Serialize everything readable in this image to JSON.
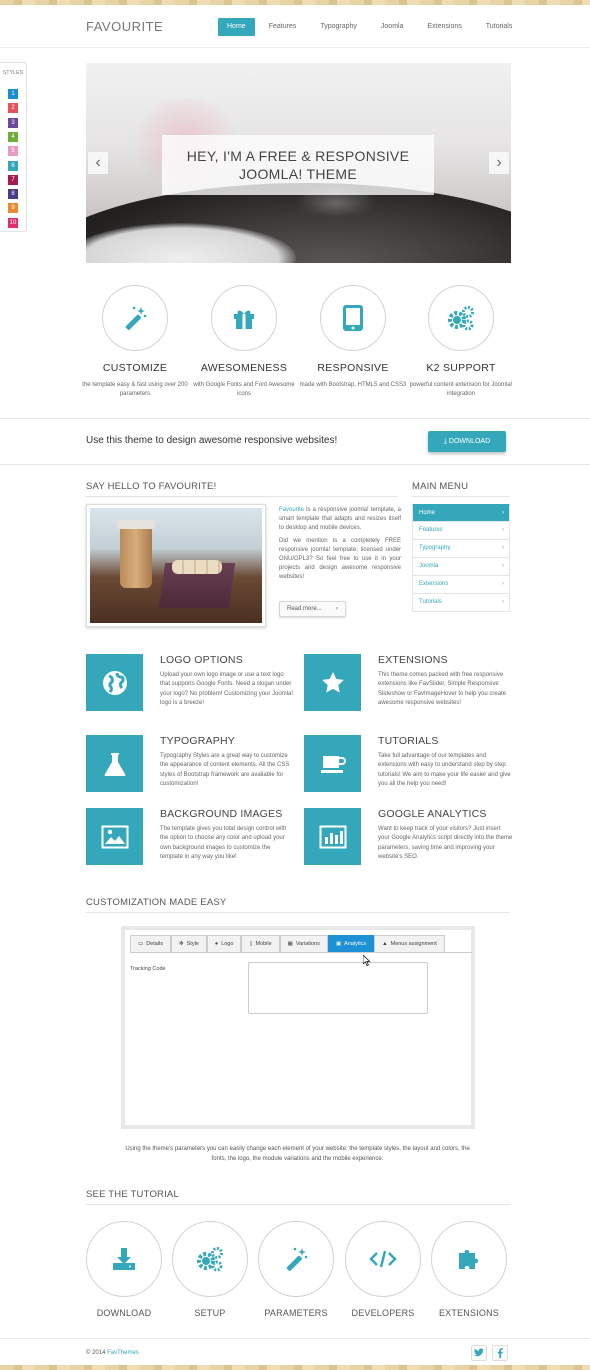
{
  "brand": {
    "name": "FAVOURITE",
    "accent": "#34a8ba"
  },
  "nav": {
    "items": [
      "Home",
      "Features",
      "Typography",
      "Joomla",
      "Extensions",
      "Tutorials"
    ],
    "active": "Home"
  },
  "styles_panel": {
    "label": "STYLES",
    "swatches": [
      {
        "n": "1",
        "color": "#1b8fd0"
      },
      {
        "n": "2",
        "color": "#e5535e"
      },
      {
        "n": "3",
        "color": "#6a4a9a"
      },
      {
        "n": "4",
        "color": "#6fae3a"
      },
      {
        "n": "5",
        "color": "#e89ac3"
      },
      {
        "n": "6",
        "color": "#34a8ba"
      },
      {
        "n": "7",
        "color": "#a61b52"
      },
      {
        "n": "8",
        "color": "#4a3a8a"
      },
      {
        "n": "9",
        "color": "#e88a2e"
      },
      {
        "n": "10",
        "color": "#e0316d"
      }
    ]
  },
  "hero": {
    "line1": "HEY, I'M A FREE & RESPONSIVE",
    "line2": "JOOMLA! THEME",
    "prev": "prev-arrow",
    "next": "next-arrow"
  },
  "features": [
    {
      "title": "CUSTOMIZE",
      "text": "the template easy & fast using over 200 parameters",
      "icon": "magic-wand-icon"
    },
    {
      "title": "AWESOMENESS",
      "text": "with Google Fonts and Font Awesome icons",
      "icon": "gift-icon"
    },
    {
      "title": "RESPONSIVE",
      "text": "made with Bootstrap, HTML5 and CSS3",
      "icon": "tablet-icon"
    },
    {
      "title": "K2 SUPPORT",
      "text": "powerful content extension for Joomla! integration",
      "icon": "gears-icon"
    }
  ],
  "band": {
    "message": "Use this theme to design awesome responsive websites!",
    "button": "DOWNLOAD"
  },
  "hello": {
    "heading": "SAY HELLO TO FAVOURITE!",
    "link": "Favourite",
    "p1": " is a responsive joomla! template, a smart template that adapts and resizes itself to desktop and mobile devices.",
    "p2": "Did we mention is a completely FREE responsive joomla! template, licensed under GNU/GPL3? So feel free to use it in your projects and design awesome responsive websites!",
    "readmore": "Read more..."
  },
  "main_menu": {
    "heading": "MAIN MENU",
    "items": [
      "Home",
      "Features",
      "Typography",
      "Joomla",
      "Extensions",
      "Tutorials"
    ]
  },
  "feature_boxes": [
    {
      "title": "LOGO OPTIONS",
      "text": "Upload your own logo image or use a text logo that supports Google Fonts. Need a slogan under your logo? No problem! Customizing your Joomla! logo is a breeze!",
      "icon": "globe-icon"
    },
    {
      "title": "EXTENSIONS",
      "text": "This theme comes packed with free responsive extensions like FavSlider, Simple Responsive Slideshow or FavImageHover to help you create awesome responsive websites!",
      "icon": "star-icon"
    },
    {
      "title": "TYPOGRAPHY",
      "text": "Typography Styles are a great way to customize the appearance of content elements. All the CSS styles of Bootstrap framework are available for customization!",
      "icon": "flask-icon"
    },
    {
      "title": "TUTORIALS",
      "text": "Take full advantage of our templates and extensions with easy to understand step by step tutorials! We aim to make your life easier and give you all the help you need!",
      "icon": "coffee-icon"
    },
    {
      "title": "BACKGROUND IMAGES",
      "text": "The template gives you total design control with the option to choose any color and upload your own background images to customize the template in any way you like!",
      "icon": "picture-icon"
    },
    {
      "title": "GOOGLE ANALYTICS",
      "text": "Want to keep track of your visitors? Just insert your Google Analytics script directly into the theme parameters, saving time and improving your website's SEO.",
      "icon": "bar-chart-icon"
    }
  ],
  "customization": {
    "heading": "CUSTOMIZATION MADE EASY",
    "tabs": [
      "Details",
      "Style",
      "Logo",
      "Mobile",
      "Variations",
      "Analytics",
      "Menus assignment"
    ],
    "active_tab": "Analytics",
    "field_label": "Tracking Code",
    "caption": "Using the theme's parameters you can easily change each element of your website: the template styles, the layout and colors, the fonts, the logo, the module variations and the mobile experience."
  },
  "tutorial": {
    "heading": "SEE THE TUTORIAL",
    "items": [
      "DOWNLOAD",
      "SETUP",
      "PARAMETERS",
      "DEVELOPERS",
      "EXTENSIONS"
    ]
  },
  "footer": {
    "copyright": "© 2014 ",
    "company": "FavThemes"
  }
}
